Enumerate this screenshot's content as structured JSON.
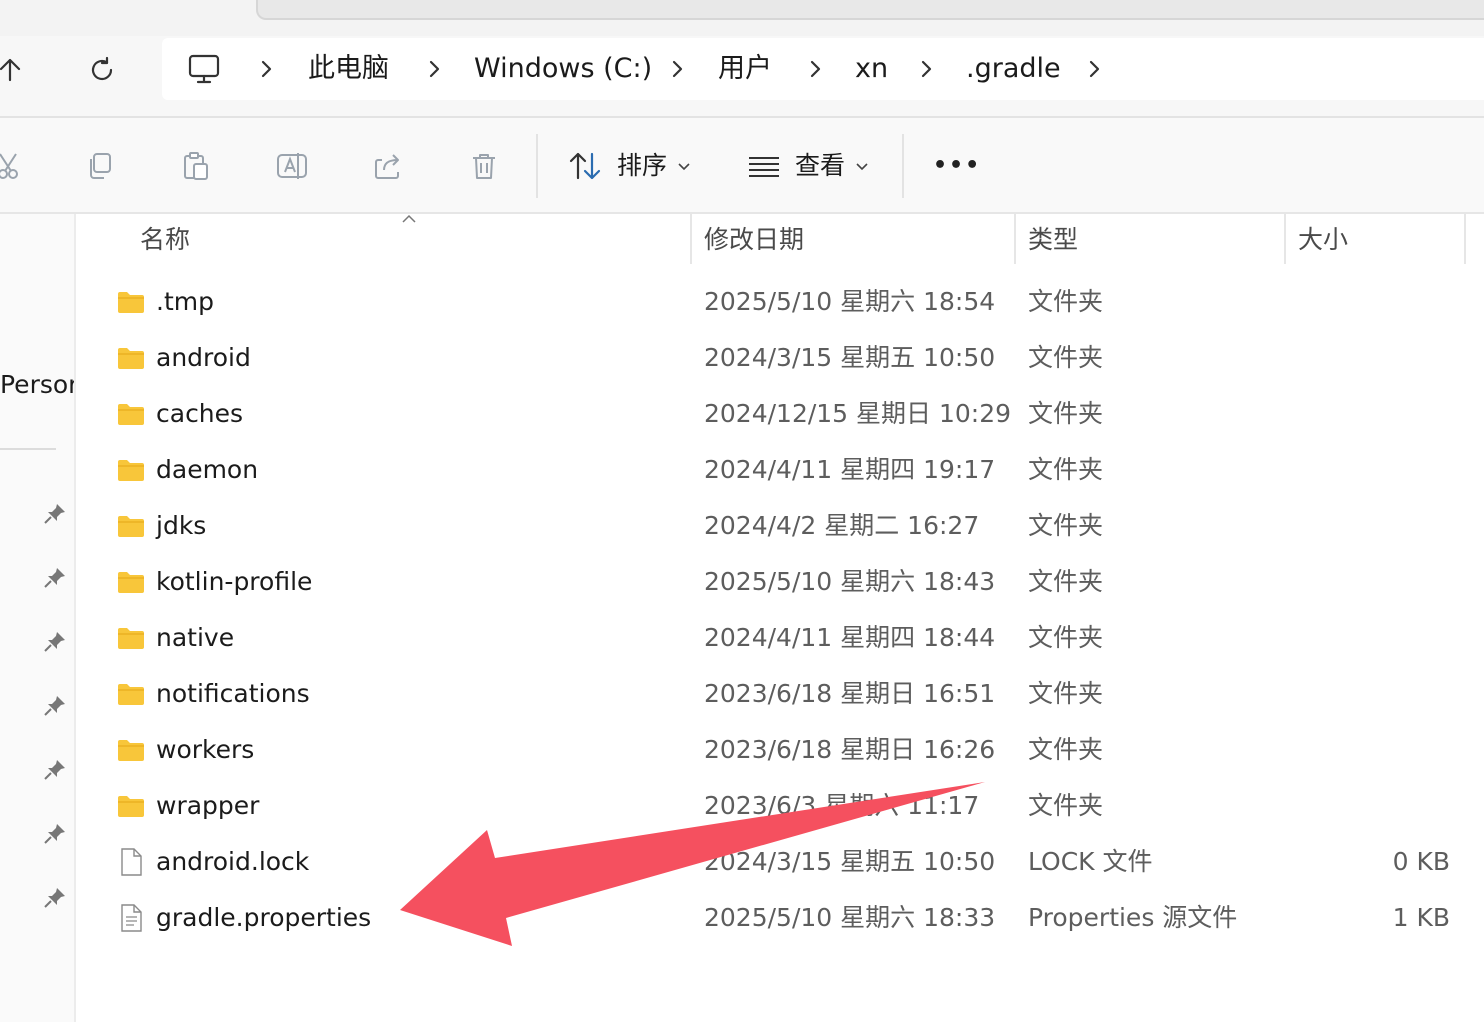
{
  "breadcrumb": {
    "items": [
      {
        "label": "此电脑"
      },
      {
        "label": "Windows (C:)"
      },
      {
        "label": "用户"
      },
      {
        "label": "xn"
      },
      {
        "label": ".gradle"
      }
    ]
  },
  "toolbar": {
    "sort_label": "排序",
    "view_label": "查看",
    "more_label": "•••"
  },
  "leftpane": {
    "partial_label": "Persor"
  },
  "columns": {
    "name": "名称",
    "date": "修改日期",
    "type": "类型",
    "size": "大小"
  },
  "files": [
    {
      "name": ".tmp",
      "date": "2025/5/10 星期六 18:54",
      "type": "文件夹",
      "size": "",
      "kind": "folder"
    },
    {
      "name": "android",
      "date": "2024/3/15 星期五 10:50",
      "type": "文件夹",
      "size": "",
      "kind": "folder"
    },
    {
      "name": "caches",
      "date": "2024/12/15 星期日 10:29",
      "type": "文件夹",
      "size": "",
      "kind": "folder"
    },
    {
      "name": "daemon",
      "date": "2024/4/11 星期四 19:17",
      "type": "文件夹",
      "size": "",
      "kind": "folder"
    },
    {
      "name": "jdks",
      "date": "2024/4/2 星期二 16:27",
      "type": "文件夹",
      "size": "",
      "kind": "folder"
    },
    {
      "name": "kotlin-profile",
      "date": "2025/5/10 星期六 18:43",
      "type": "文件夹",
      "size": "",
      "kind": "folder"
    },
    {
      "name": "native",
      "date": "2024/4/11 星期四 18:44",
      "type": "文件夹",
      "size": "",
      "kind": "folder"
    },
    {
      "name": "notifications",
      "date": "2023/6/18 星期日 16:51",
      "type": "文件夹",
      "size": "",
      "kind": "folder"
    },
    {
      "name": "workers",
      "date": "2023/6/18 星期日 16:26",
      "type": "文件夹",
      "size": "",
      "kind": "folder"
    },
    {
      "name": "wrapper",
      "date": "2023/6/3 星期六 11:17",
      "type": "文件夹",
      "size": "",
      "kind": "folder"
    },
    {
      "name": "android.lock",
      "date": "2024/3/15 星期五 10:50",
      "type": "LOCK 文件",
      "size": "0 KB",
      "kind": "file"
    },
    {
      "name": "gradle.properties",
      "date": "2025/5/10 星期六 18:33",
      "type": "Properties 源文件",
      "size": "1 KB",
      "kind": "text-file"
    }
  ],
  "annotation": {
    "color": "#f5505f",
    "points_to": "gradle.properties"
  },
  "colors": {
    "folder": "#f8c63a",
    "accent": "#2b6cb0"
  }
}
